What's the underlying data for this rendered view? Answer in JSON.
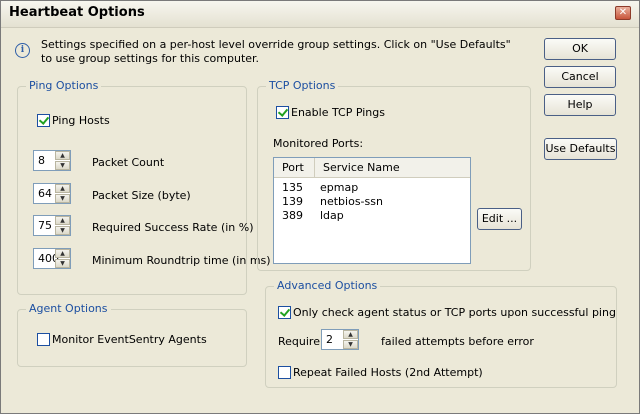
{
  "window": {
    "title": "Heartbeat Options"
  },
  "info": {
    "text": "Settings specified on a per-host level override group settings. Click on \"Use Defaults\" to use group settings for this computer."
  },
  "buttons": {
    "ok": "OK",
    "cancel": "Cancel",
    "help": "Help",
    "use_defaults": "Use Defaults"
  },
  "ping_options": {
    "title": "Ping Options",
    "ping_hosts": {
      "label": "Ping Hosts",
      "checked": true
    },
    "packet_count": {
      "value": "8",
      "label": "Packet Count"
    },
    "packet_size": {
      "value": "64",
      "label": "Packet Size (byte)"
    },
    "success_rate": {
      "value": "75",
      "label": "Required Success Rate (in %)"
    },
    "roundtrip": {
      "value": "400",
      "label": "Minimum Roundtrip time (in ms)"
    }
  },
  "tcp_options": {
    "title": "TCP Options",
    "enable_tcp": {
      "label": "Enable TCP Pings",
      "checked": true
    },
    "monitored_ports_label": "Monitored Ports:",
    "columns": [
      "Port",
      "Service Name"
    ],
    "rows": [
      {
        "port": "135",
        "service": "epmap"
      },
      {
        "port": "139",
        "service": "netbios-ssn"
      },
      {
        "port": "389",
        "service": "ldap"
      }
    ],
    "edit_button": "Edit ..."
  },
  "agent_options": {
    "title": "Agent Options",
    "monitor": {
      "label": "Monitor EventSentry Agents",
      "checked": false
    }
  },
  "advanced_options": {
    "title": "Advanced Options",
    "only_check": {
      "label": "Only check agent status or TCP ports upon successful ping",
      "checked": true
    },
    "require_label": "Require",
    "require_value": "2",
    "failed_label": "failed attempts before error",
    "repeat": {
      "label": "Repeat Failed Hosts (2nd Attempt)",
      "checked": false
    }
  }
}
